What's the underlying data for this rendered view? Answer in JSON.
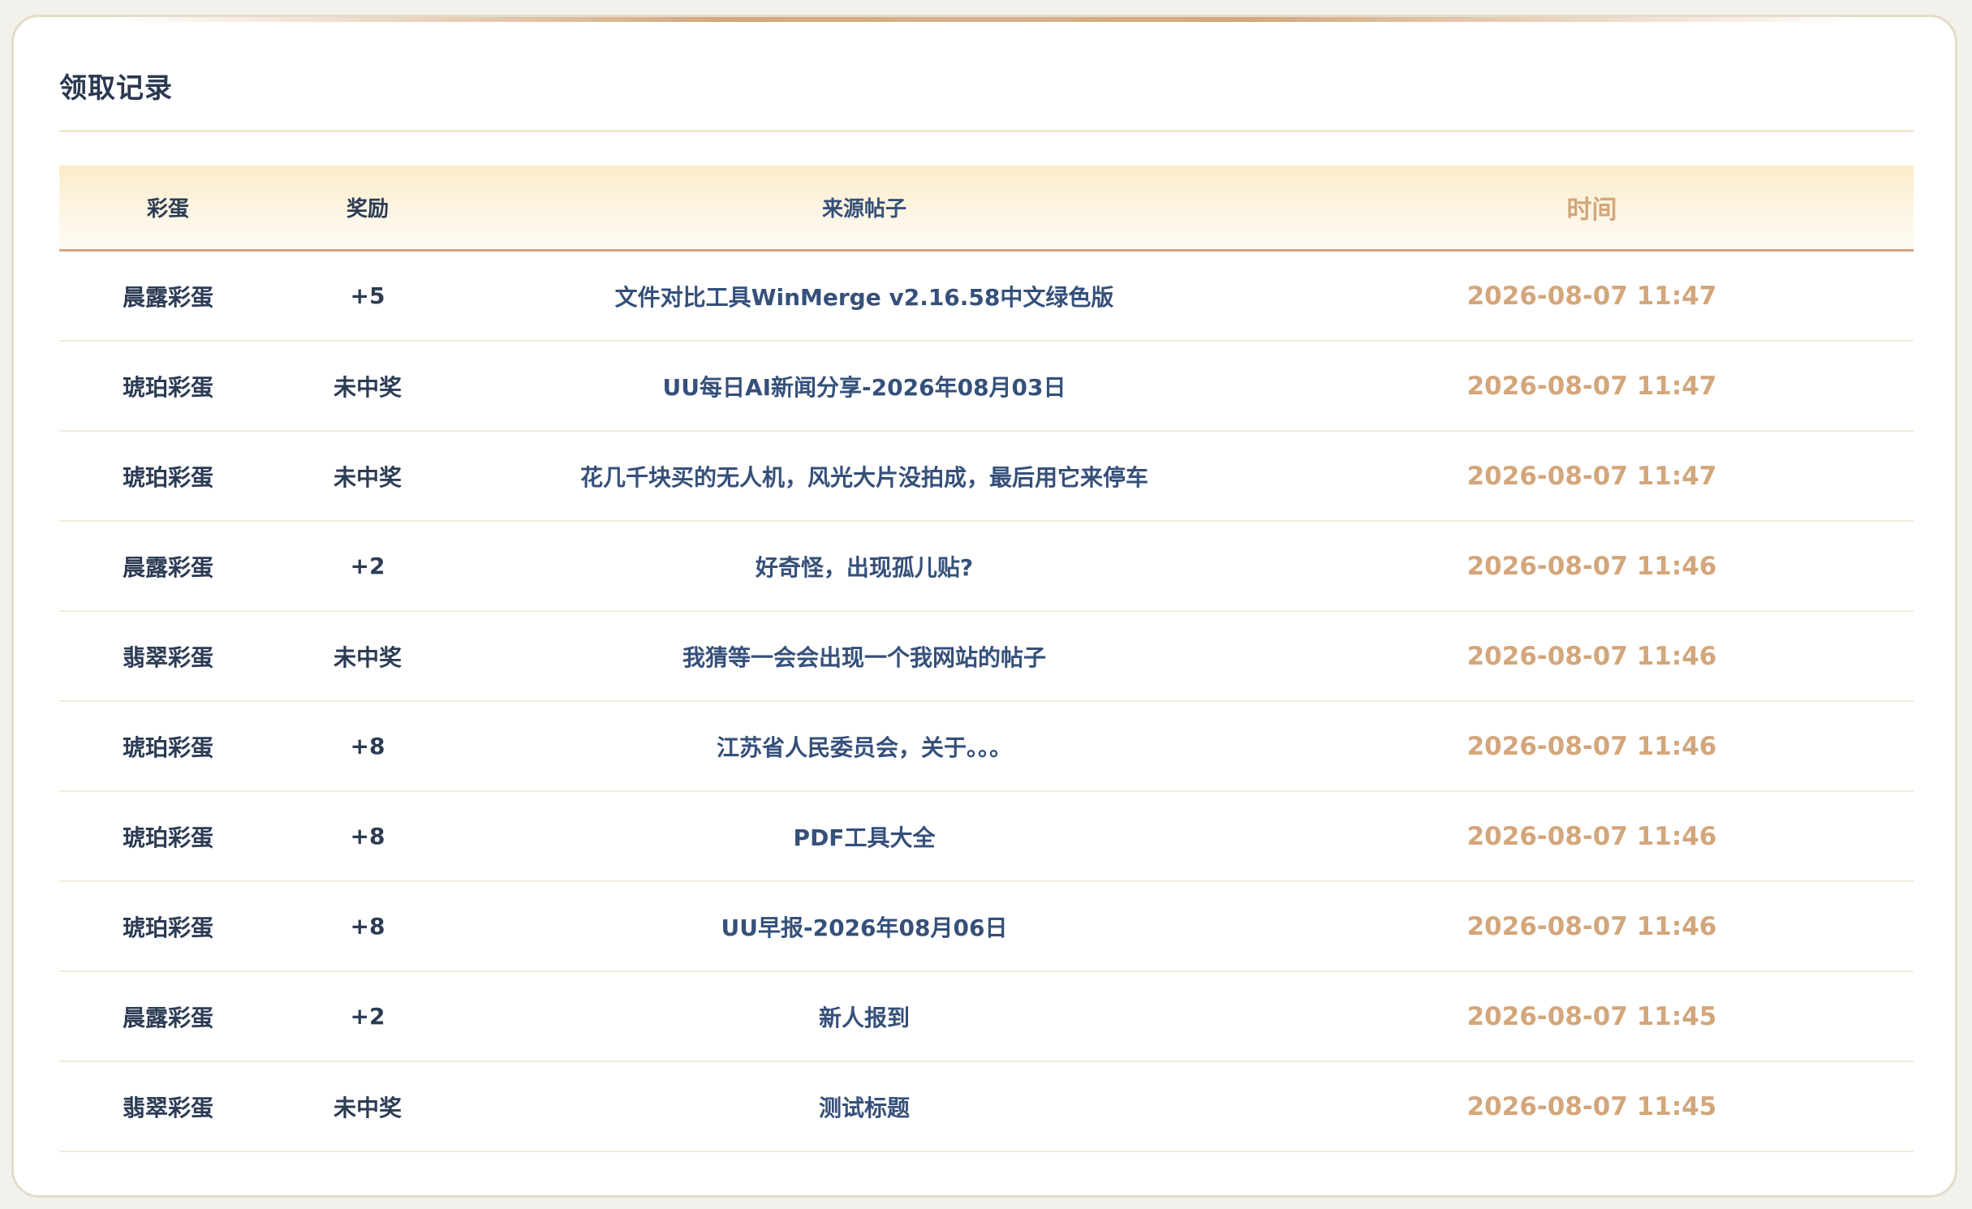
{
  "panel": {
    "title": "领取记录"
  },
  "table": {
    "headers": {
      "egg": "彩蛋",
      "reward": "奖励",
      "post": "来源帖子",
      "time": "时间"
    },
    "rows": [
      {
        "egg": "晨露彩蛋",
        "reward": "+5",
        "post": "文件对比工具WinMerge v2.16.58中文绿色版",
        "time": "2026-08-07 11:47"
      },
      {
        "egg": "琥珀彩蛋",
        "reward": "未中奖",
        "post": "UU每日AI新闻分享-2026年08月03日",
        "time": "2026-08-07 11:47"
      },
      {
        "egg": "琥珀彩蛋",
        "reward": "未中奖",
        "post": "花几千块买的无人机，风光大片没拍成，最后用它来停车",
        "time": "2026-08-07 11:47"
      },
      {
        "egg": "晨露彩蛋",
        "reward": "+2",
        "post": "好奇怪，出现孤儿贴?",
        "time": "2026-08-07 11:46"
      },
      {
        "egg": "翡翠彩蛋",
        "reward": "未中奖",
        "post": "我猜等一会会出现一个我网站的帖子",
        "time": "2026-08-07 11:46"
      },
      {
        "egg": "琥珀彩蛋",
        "reward": "+8",
        "post": "江苏省人民委员会，关于。。。",
        "time": "2026-08-07 11:46"
      },
      {
        "egg": "琥珀彩蛋",
        "reward": "+8",
        "post": "PDF工具大全",
        "time": "2026-08-07 11:46"
      },
      {
        "egg": "琥珀彩蛋",
        "reward": "+8",
        "post": "UU早报-2026年08月06日",
        "time": "2026-08-07 11:46"
      },
      {
        "egg": "晨露彩蛋",
        "reward": "+2",
        "post": "新人报到",
        "time": "2026-08-07 11:45"
      },
      {
        "egg": "翡翠彩蛋",
        "reward": "未中奖",
        "post": "测试标题",
        "time": "2026-08-07 11:45"
      }
    ]
  },
  "colors": {
    "time_text": "#d3a67b",
    "post_link": "#35507a",
    "header_bg": "#fcecc8"
  }
}
